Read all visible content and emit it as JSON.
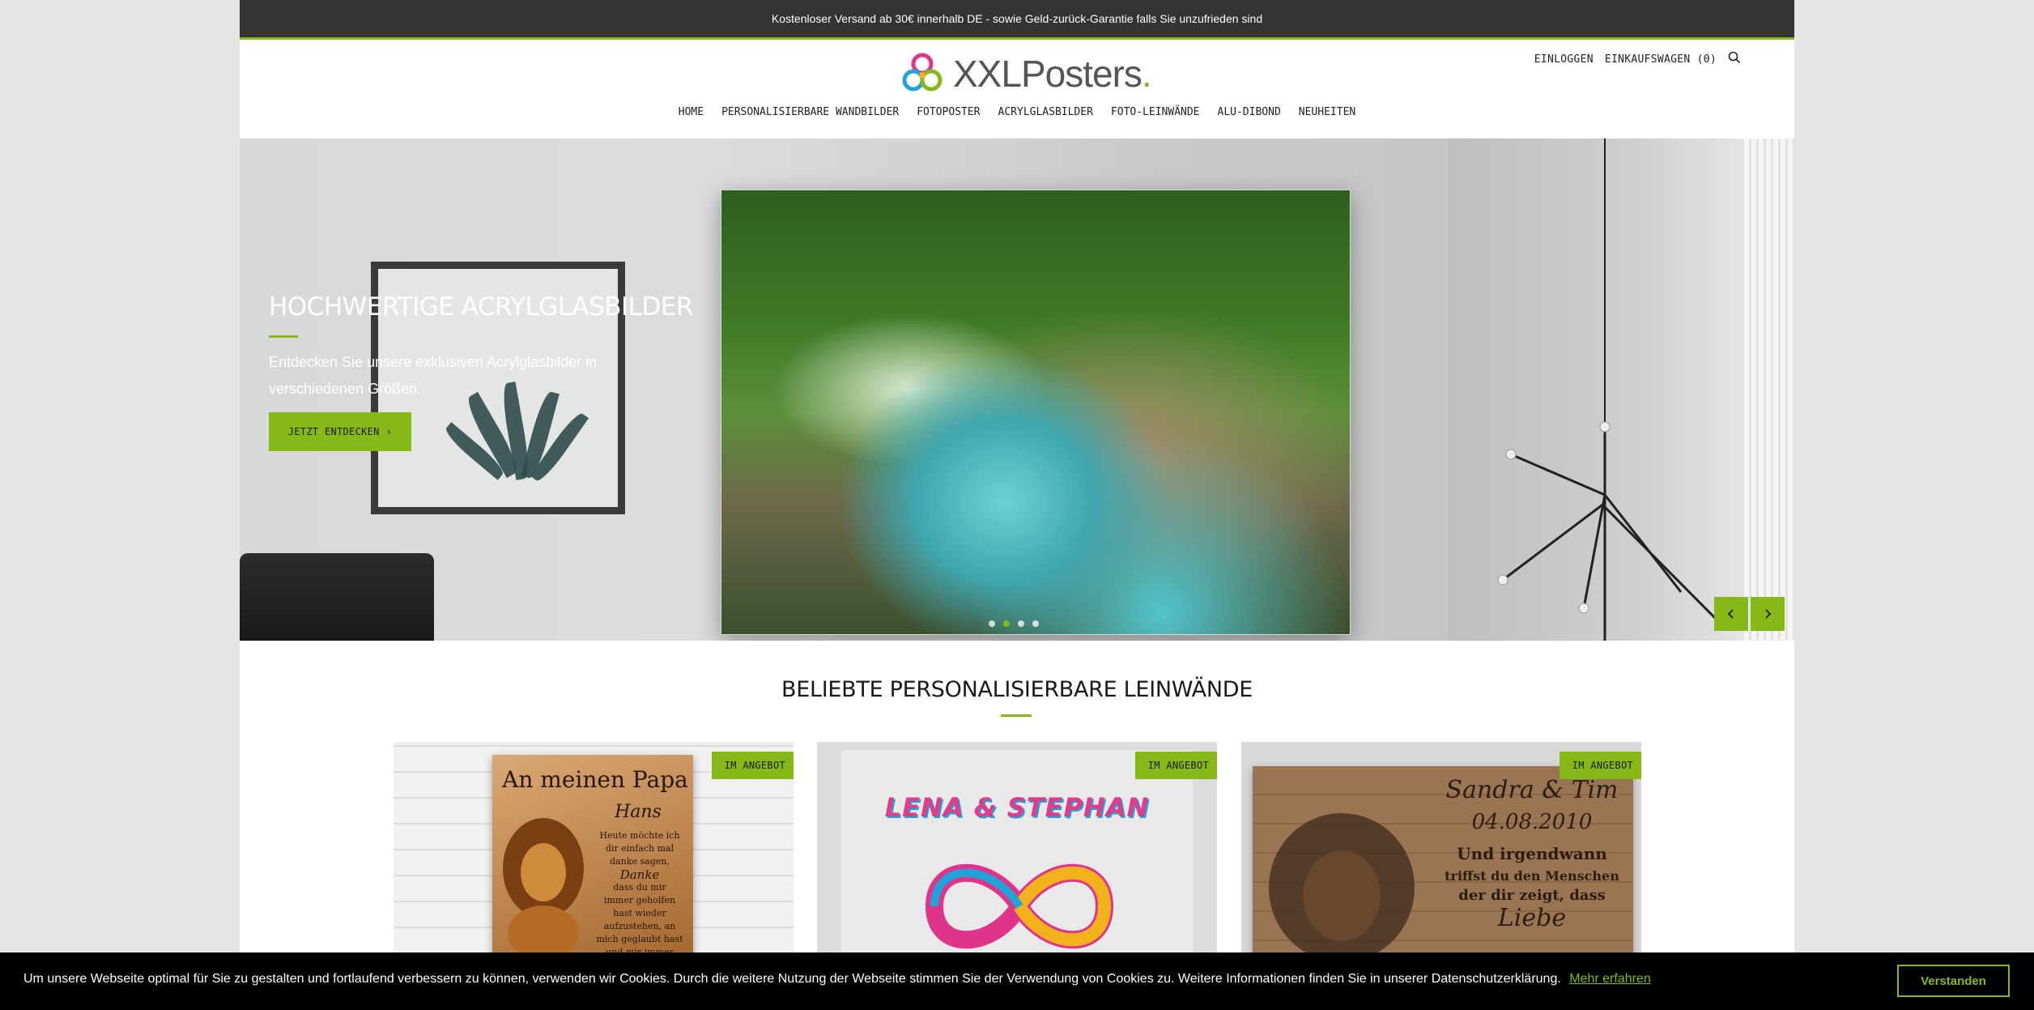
{
  "announcement": "Kostenloser Versand ab 30€ innerhalb DE - sowie Geld-zurück-Garantie falls Sie unzufrieden sind",
  "brand": {
    "name": "XXLPosters",
    "dot": ".",
    "accent": "#86b817"
  },
  "header": {
    "login": "EINLOGGEN",
    "cart": "EINKAUFSWAGEN (0)",
    "search_icon": "search-icon"
  },
  "nav": [
    "HOME",
    "PERSONALISIERBARE WANDBILDER",
    "FOTOPOSTER",
    "ACRYLGLASBILDER",
    "FOTO-LEINWÄNDE",
    "ALU-DIBOND",
    "NEUHEITEN"
  ],
  "hero": {
    "title": "HOCHWERTIGE ACRYLGLASBILDER",
    "subtitle": "Entdecken Sie unsere exklusiven Acrylglasbilder in verschiedenen Größen.",
    "cta": "JETZT ENTDECKEN",
    "slides_total": 4,
    "active_slide": 2
  },
  "section": {
    "title": "BELIEBTE PERSONALISIERBARE LEINWÄNDE"
  },
  "products": [
    {
      "badge": "IM ANGEBOT",
      "title": "An meinen Papa",
      "name": "Hans",
      "lines": [
        "Heute möchte ich",
        "dir einfach mal",
        "danke sagen,",
        "Danke",
        "dass du mir",
        "immer geholfen",
        "hast wieder",
        "aufzustehen, an",
        "mich geglaubt hast",
        "und mir immer"
      ]
    },
    {
      "badge": "IM ANGEBOT",
      "title": "LENA & STEPHAN"
    },
    {
      "badge": "IM ANGEBOT",
      "title": "Sandra & Tim",
      "date": "04.08.2010",
      "lines": [
        "Und irgendwann",
        "triffst du den Menschen",
        "der dir zeigt, dass",
        "Liebe"
      ]
    }
  ],
  "cookie": {
    "text": "Um unsere Webseite optimal für Sie zu gestalten und fortlaufend verbessern zu können, verwenden wir Cookies. Durch die weitere Nutzung der Webseite stimmen Sie der Verwendung von Cookies zu. Weitere Informationen finden Sie in unserer Datenschutzerklärung.",
    "link": "Mehr erfahren",
    "button": "Verstanden"
  }
}
